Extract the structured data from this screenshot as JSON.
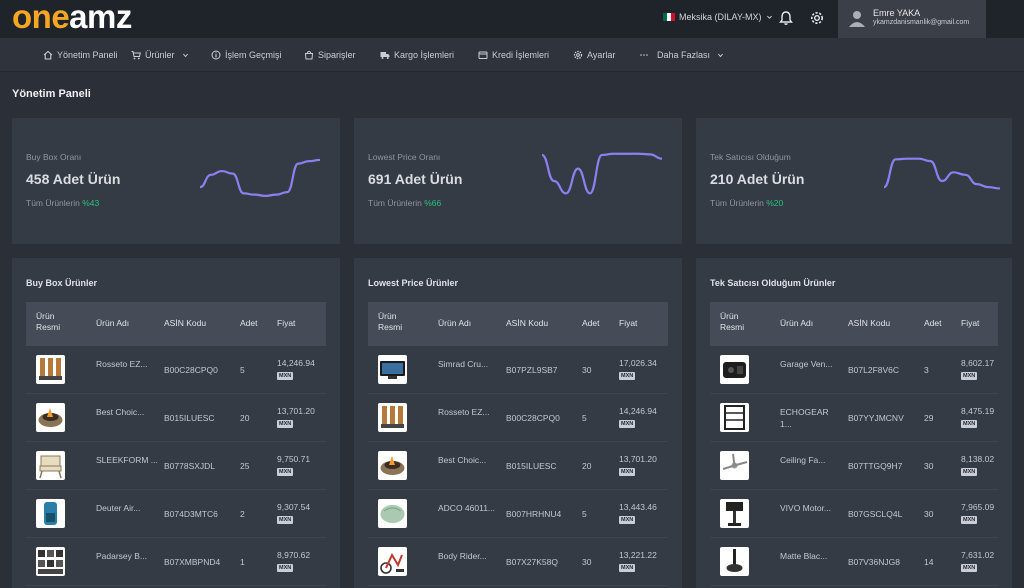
{
  "header": {
    "logo_one": "one",
    "logo_amz": "amz",
    "country": "Meksika (DILAY-MX)",
    "user_name": "Emre YAKA",
    "user_email": "ykamzdanismanlik@gmail.com"
  },
  "nav": {
    "items": [
      {
        "label": "Yönetim Paneli"
      },
      {
        "label": "Ürünler"
      },
      {
        "label": "İşlem Geçmişi"
      },
      {
        "label": "Siparişler"
      },
      {
        "label": "Kargo İşlemleri"
      },
      {
        "label": "Kredi İşlemleri"
      },
      {
        "label": "Ayarlar"
      },
      {
        "label": "Daha Fazlası"
      }
    ]
  },
  "page": {
    "title": "Yönetim Paneli"
  },
  "stats": [
    {
      "label": "Buy Box Oranı",
      "value": "458 Adet Ürün",
      "sub": "Tüm Ürünlerin",
      "pct": "%43",
      "trend": [
        40,
        60,
        66,
        62,
        30,
        28,
        26,
        28,
        32,
        78,
        82,
        84
      ]
    },
    {
      "label": "Lowest Price Oranı",
      "value": "691 Adet Ürün",
      "sub": "Tüm Ürünlerin",
      "pct": "%66",
      "trend": [
        92,
        50,
        30,
        70,
        30,
        92,
        94,
        94,
        94,
        93,
        86
      ]
    },
    {
      "label": "Tek Satıcısı Olduğum",
      "value": "210 Adet Ürün",
      "sub": "Tüm Ürünlerin",
      "pct": "%20",
      "trend": [
        40,
        85,
        86,
        86,
        82,
        50,
        64,
        60,
        45,
        40,
        38
      ]
    }
  ],
  "columns": {
    "image": "Ürün Resmi",
    "name": "Ürün Adı",
    "asin": "ASİN Kodu",
    "qty": "Adet",
    "price": "Fiyat"
  },
  "currency": "MXN",
  "lists": [
    {
      "title": "Buy Box Ürünler",
      "rows": [
        {
          "name": "Rosseto EZ...",
          "asin": "B00C28CPQ0",
          "qty": "5",
          "price": "14,246.94",
          "icon": "dispenser"
        },
        {
          "name": "Best Choic...",
          "asin": "B015ILUESC",
          "qty": "20",
          "price": "13,701.20",
          "icon": "firepit"
        },
        {
          "name": "SLEEKFORM ...",
          "asin": "B0778SXJDL",
          "qty": "25",
          "price": "9,750.71",
          "icon": "chair"
        },
        {
          "name": "Deuter Air...",
          "asin": "B074D3MTC6",
          "qty": "2",
          "price": "9,307.54",
          "icon": "backpack"
        },
        {
          "name": "Padarsey B...",
          "asin": "B07XMBPND4",
          "qty": "1",
          "price": "8,970.62",
          "icon": "parts"
        }
      ]
    },
    {
      "title": "Lowest Price Ürünler",
      "rows": [
        {
          "name": "Simrad Cru...",
          "asin": "B07PZL9SB7",
          "qty": "30",
          "price": "17,026.34",
          "icon": "monitor"
        },
        {
          "name": "Rosseto EZ...",
          "asin": "B00C28CPQ0",
          "qty": "5",
          "price": "14,246.94",
          "icon": "dispenser"
        },
        {
          "name": "Best Choic...",
          "asin": "B015ILUESC",
          "qty": "20",
          "price": "13,701.20",
          "icon": "firepit"
        },
        {
          "name": "ADCO 46011...",
          "asin": "B007HRHNU4",
          "qty": "5",
          "price": "13,443.46",
          "icon": "cover"
        },
        {
          "name": "Body Rider...",
          "asin": "B07X27K58Q",
          "qty": "30",
          "price": "13,221.22",
          "icon": "bike"
        }
      ]
    },
    {
      "title": "Tek Satıcısı Olduğum Ürünler",
      "rows": [
        {
          "name": "Garage Ven...",
          "asin": "B07L2F8V6C",
          "qty": "3",
          "price": "8,602.17",
          "icon": "console"
        },
        {
          "name": "ECHOGEAR 1...",
          "asin": "B07YYJMCNV",
          "qty": "29",
          "price": "8,475.19",
          "icon": "rack"
        },
        {
          "name": "Ceiling Fa...",
          "asin": "B07TTGQ9H7",
          "qty": "30",
          "price": "8,138.02",
          "icon": "fan"
        },
        {
          "name": "VIVO Motor...",
          "asin": "B07GSCLQ4L",
          "qty": "30",
          "price": "7,965.09",
          "icon": "stand"
        },
        {
          "name": "Matte Blac...",
          "asin": "B07V36NJG8",
          "qty": "14",
          "price": "7,631.02",
          "icon": "light"
        }
      ]
    }
  ],
  "colors": {
    "accent": "#f5a623",
    "positive": "#27c281",
    "sparkline": "#8e7ff0"
  }
}
